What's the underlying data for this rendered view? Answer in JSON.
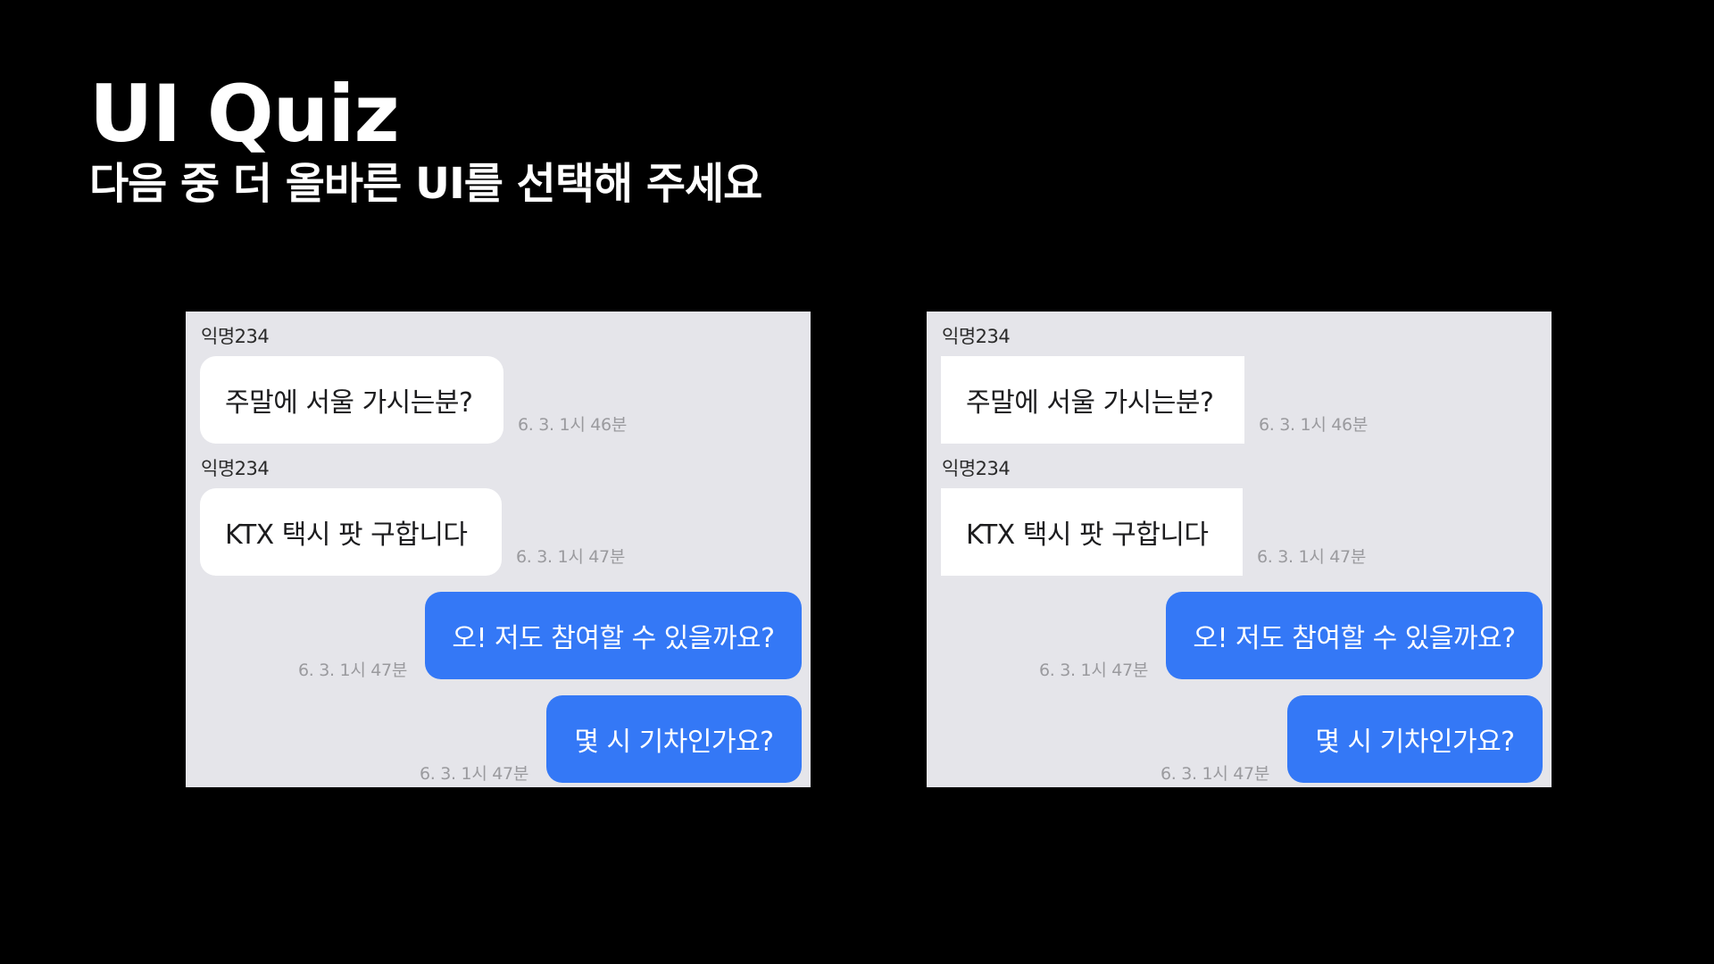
{
  "slide": {
    "title": "UI Quiz",
    "subtitle": "다음 중 더 올바른 UI를 선택해 주세요"
  },
  "colors": {
    "background": "#000000",
    "chat_background": "#e5e5ea",
    "incoming_bubble": "#ffffff",
    "outgoing_bubble": "#3478f6",
    "timestamp": "#9a9a9e"
  },
  "options": [
    {
      "incoming_bubble_style": "rounded",
      "messages": [
        {
          "sender": "익명234",
          "text": "주말에 서울 가시는분?",
          "time": "6. 3. 1시 46분",
          "direction": "incoming"
        },
        {
          "sender": "익명234",
          "text": "KTX 택시 팟 구합니다",
          "time": "6. 3. 1시 47분",
          "direction": "incoming"
        },
        {
          "text": "오! 저도 참여할 수 있을까요?",
          "time": "6. 3. 1시 47분",
          "direction": "outgoing"
        },
        {
          "text": "몇 시 기차인가요?",
          "time": "6. 3. 1시 47분",
          "direction": "outgoing"
        }
      ]
    },
    {
      "incoming_bubble_style": "square",
      "messages": [
        {
          "sender": "익명234",
          "text": "주말에 서울 가시는분?",
          "time": "6. 3. 1시 46분",
          "direction": "incoming"
        },
        {
          "sender": "익명234",
          "text": "KTX 택시 팟 구합니다",
          "time": "6. 3. 1시 47분",
          "direction": "incoming"
        },
        {
          "text": "오! 저도 참여할 수 있을까요?",
          "time": "6. 3. 1시 47분",
          "direction": "outgoing"
        },
        {
          "text": "몇 시 기차인가요?",
          "time": "6. 3. 1시 47분",
          "direction": "outgoing"
        }
      ]
    }
  ]
}
